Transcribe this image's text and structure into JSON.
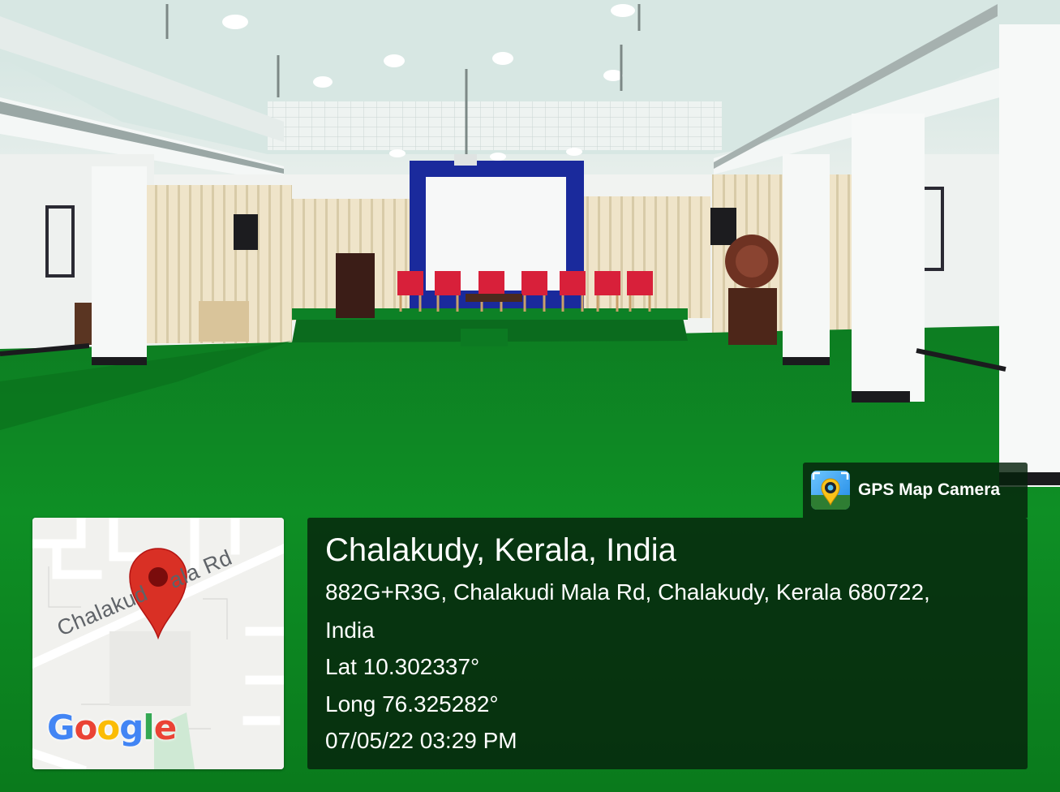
{
  "app": {
    "name": "GPS Map Camera",
    "icon": "map-pin-camera-icon"
  },
  "location": {
    "place": "Chalakudy, Kerala, India",
    "address_line1": "882G+R3G, Chalakudi Mala Rd, Chalakudy, Kerala 680722,",
    "address_line2": "India",
    "latitude": "Lat 10.302337°",
    "longitude": "Long 76.325282°",
    "timestamp": "07/05/22 03:29 PM"
  },
  "map": {
    "road_label": "Chalakud    ala Rd",
    "logo_letters": [
      "G",
      "o",
      "o",
      "g",
      "l",
      "e"
    ],
    "logo_colors": [
      "#4285F4",
      "#EA4335",
      "#FBBC05",
      "#4285F4",
      "#34A853",
      "#EA4335"
    ],
    "pin_color": "#D93025",
    "pin_icon": "map-pin-icon"
  },
  "scene": {
    "description_colors": {
      "carpet": "#0c8a22",
      "wall": "#f2f4f2",
      "curtain": "#e9dfc4",
      "screen_frame": "#1a2a9c",
      "chairs": "#d8203a"
    }
  }
}
